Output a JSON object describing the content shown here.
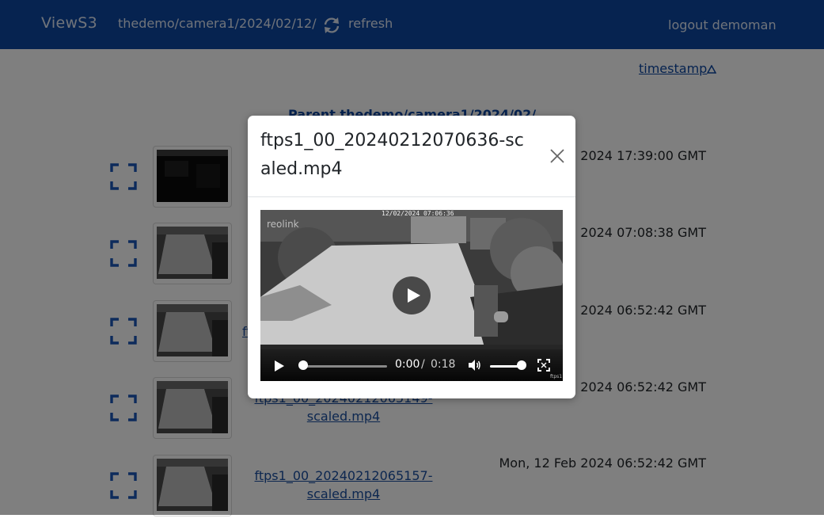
{
  "navbar": {
    "brand": "ViewS3",
    "path": "thedemo/camera1/2024/02/12/",
    "refresh_label": "refresh",
    "logout_label": "logout demoman",
    "color": "#0d47a1"
  },
  "listing": {
    "sort_label": "timestamp",
    "parent_label": "Parent thedemo/camera1/2024/02/",
    "rows": [
      {
        "name": "",
        "date": "2024 17:39:00 GMT"
      },
      {
        "name": "",
        "date": "2024 07:08:38 GMT"
      },
      {
        "name": "ft",
        "date": "2024 06:52:42 GMT"
      },
      {
        "name": "ftps1_00_20240212065149-scaled.mp4",
        "date": "2024 06:52:42 GMT"
      },
      {
        "name": "ftps1_00_20240212065157-scaled.mp4",
        "date": "Mon, 12 Feb 2024 06:52:42 GMT"
      }
    ]
  },
  "modal": {
    "title": "ftps1_00_20240212070636-scaled.mp4",
    "video": {
      "overlay_timestamp": "12/02/2024 07:06:36",
      "logo_text": "reolink",
      "current_time": "0:00",
      "separator": "/",
      "duration": "0:18",
      "progress": 0,
      "volume": 1.0,
      "corner_text": "ftps1"
    }
  },
  "icons": {
    "refresh": "refresh-icon",
    "sort_direction": "triangle-up-icon",
    "expand": "expand-icon",
    "close": "close-icon",
    "play": "play-icon",
    "volume": "volume-icon",
    "fullscreen": "fullscreen-icon"
  }
}
